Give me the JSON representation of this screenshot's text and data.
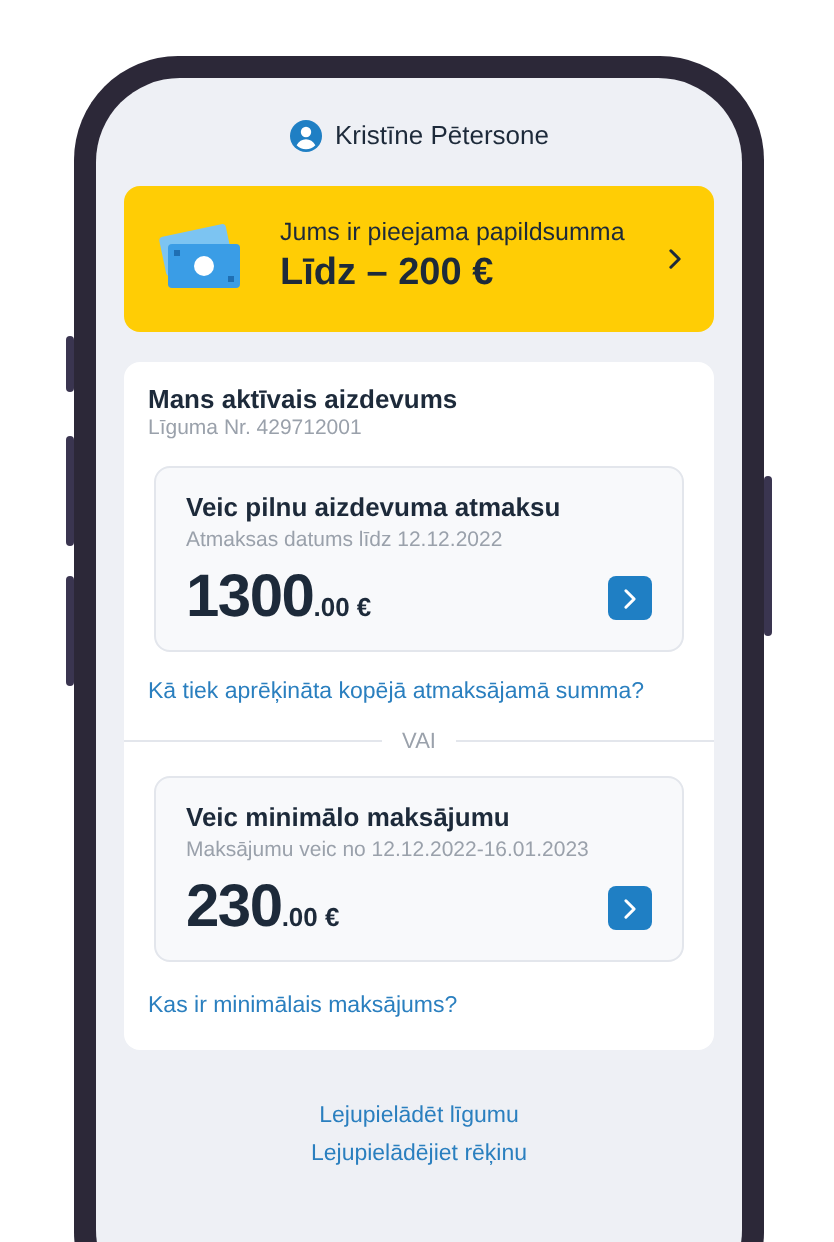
{
  "header": {
    "user_name": "Kristīne Pētersone"
  },
  "banner": {
    "title": "Jums ir pieejama papildsumma",
    "amount": "Līdz – 200 €"
  },
  "loan": {
    "title": "Mans aktīvais aizdevums",
    "contract": "Līguma Nr. 429712001",
    "options": [
      {
        "title": "Veic pilnu aizdevuma atmaksu",
        "subtitle": "Atmaksas datums līdz 12.12.2022",
        "amount_main": "1300",
        "amount_fraction": ".00 €",
        "link": "Kā tiek aprēķināta kopējā atmaksājamā summa?"
      },
      {
        "title": "Veic minimālo maksājumu",
        "subtitle": "Maksājumu veic no 12.12.2022-16.01.2023",
        "amount_main": "230",
        "amount_fraction": ".00 €",
        "link": "Kas ir minimālais maksājums?"
      }
    ],
    "separator": "VAI"
  },
  "footer_links": [
    "Lejupielādēt līgumu",
    "Lejupielādējiet rēķinu"
  ]
}
